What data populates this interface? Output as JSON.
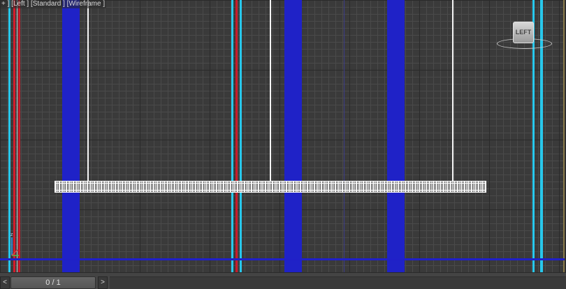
{
  "viewport": {
    "label": "+ ] [Left ] [Standard ] [Wireframe ]"
  },
  "viewcube": {
    "label": "LEFT"
  },
  "axis_gizmo": {
    "z_label": "z"
  },
  "timeline": {
    "prev_label": "<",
    "frame_label": "0 / 1",
    "next_label": ">"
  },
  "colors": {
    "grid_background": "#3a3a3a",
    "blue_object": "#2020c8",
    "cyan_object": "#26c6e8",
    "red_object": "#d31b2a",
    "white_object": "#ffffff",
    "timeline": "#444444"
  }
}
